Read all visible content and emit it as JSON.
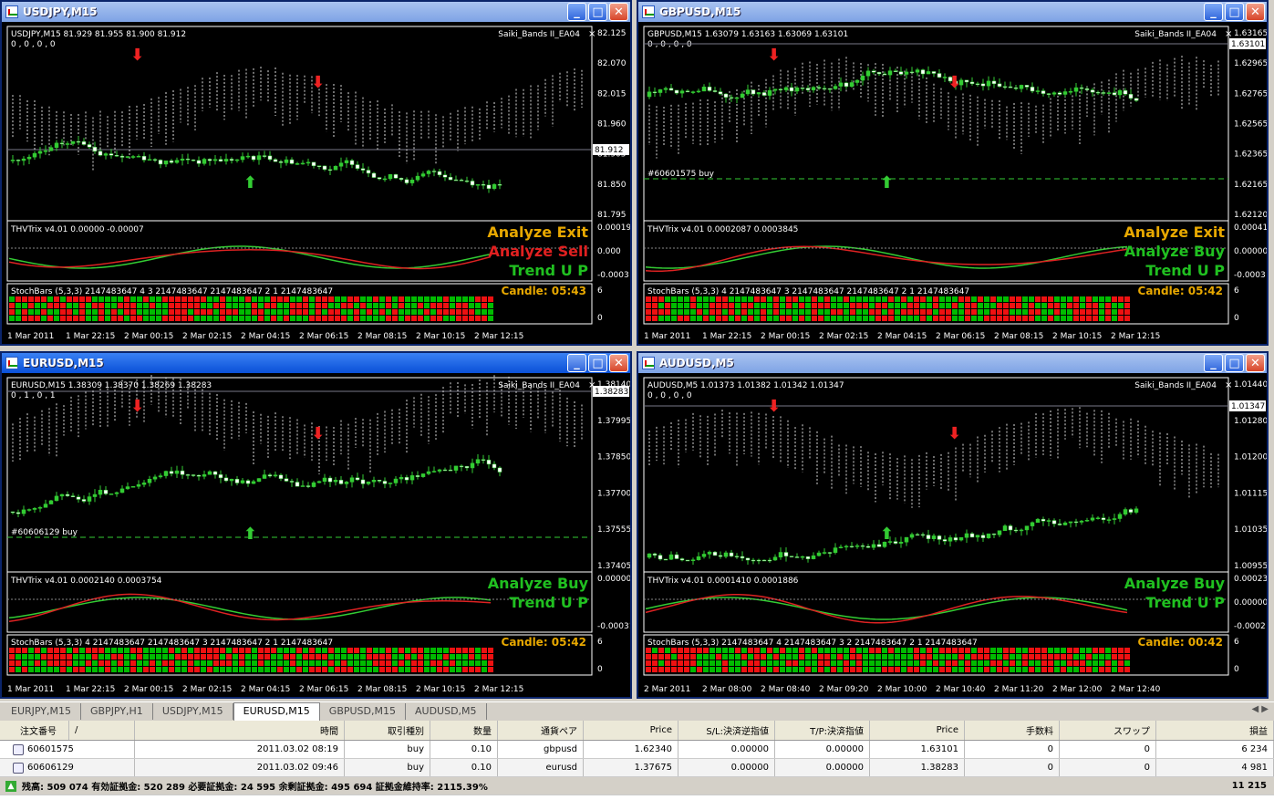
{
  "windows": [
    {
      "id": "usdjpy",
      "title": "USDJPY,M15",
      "info": "USDJPY,M15  81.929 81.955 81.900 81.912",
      "sub": "0 , 0 , 0 , 0",
      "ea": "Saiki_Bands II_EA04",
      "price": "81.912",
      "yticks": [
        "82.125",
        "82.070",
        "82.015",
        "81.960",
        "81.905",
        "81.850",
        "81.795"
      ],
      "labels": [
        {
          "text": "Analyze Exit",
          "color": "#e8a800"
        },
        {
          "text": "Analyze Sell",
          "color": "#e02020"
        },
        {
          "text": "Trend U P",
          "color": "#20c020"
        }
      ],
      "trix": "THVTrix v4.01 0.00000 -0.00007",
      "trixticks": [
        "0.00019",
        "0.000",
        "-0.0003"
      ],
      "stoch": "StochBars (5,3,3) 2147483647 4 3 2147483647 2147483647 2 1 2147483647",
      "candle": "Candle:  05:43",
      "stochticks": [
        "6",
        "0"
      ],
      "xticks": [
        "1 Mar 2011",
        "1 Mar 22:15",
        "2 Mar 00:15",
        "2 Mar 02:15",
        "2 Mar 04:15",
        "2 Mar 06:15",
        "2 Mar 08:15",
        "2 Mar 10:15",
        "2 Mar 12:15"
      ],
      "order": ""
    },
    {
      "id": "gbpusd",
      "title": "GBPUSD,M15",
      "info": "GBPUSD,M15  1.63079 1.63163 1.63069 1.63101",
      "sub": "0 , 0 , 0 , 0",
      "ea": "Saiki_Bands II_EA04",
      "price": "1.63101",
      "yticks": [
        "1.63165",
        "1.62965",
        "1.62765",
        "1.62565",
        "1.62365",
        "1.62165",
        "1.62120"
      ],
      "labels": [
        {
          "text": "Analyze Exit",
          "color": "#e8a800"
        },
        {
          "text": "Analyze Buy",
          "color": "#20c020"
        },
        {
          "text": "Trend U P",
          "color": "#20c020"
        }
      ],
      "trix": "THVTrix v4.01 0.0002087 0.0003845",
      "trixticks": [
        "0.000418",
        "0.00000",
        "-0.0003"
      ],
      "stoch": "StochBars (5,3,3) 4 2147483647 3 2147483647 2147483647 2 1 2147483647",
      "candle": "Candle:  05:42",
      "stochticks": [
        "6",
        "0"
      ],
      "xticks": [
        "1 Mar 2011",
        "1 Mar 22:15",
        "2 Mar 00:15",
        "2 Mar 02:15",
        "2 Mar 04:15",
        "2 Mar 06:15",
        "2 Mar 08:15",
        "2 Mar 10:15",
        "2 Mar 12:15"
      ],
      "order": "#60601575 buy"
    },
    {
      "id": "eurusd",
      "title": "EURUSD,M15",
      "info": "EURUSD,M15  1.38309 1.38370 1.38269 1.38283",
      "sub": "0 , 1 , 0 , 1",
      "ea": "Saiki_Bands II_EA04",
      "price": "1.38283",
      "yticks": [
        "1.38140",
        "1.37995",
        "1.37850",
        "1.37700",
        "1.37555",
        "1.37405"
      ],
      "labels": [
        {
          "text": "Analyze Buy",
          "color": "#20c020"
        },
        {
          "text": "Trend U P",
          "color": "#20c020"
        }
      ],
      "trix": "THVTrix v4.01 0.0002140 0.0003754",
      "trixticks": [
        "0.00000",
        "-0.00031"
      ],
      "stoch": "StochBars (5,3,3) 4 2147483647 2147483647 3 2147483647 2 1 2147483647",
      "candle": "Candle:  05:42",
      "stochticks": [
        "6",
        "0"
      ],
      "xticks": [
        "1 Mar 2011",
        "1 Mar 22:15",
        "2 Mar 00:15",
        "2 Mar 02:15",
        "2 Mar 04:15",
        "2 Mar 06:15",
        "2 Mar 08:15",
        "2 Mar 10:15",
        "2 Mar 12:15"
      ],
      "order": "#60606129 buy"
    },
    {
      "id": "audusd",
      "title": "AUDUSD,M5",
      "info": "AUDUSD,M5  1.01373 1.01382 1.01342 1.01347",
      "sub": "0 , 0 , 0 , 0",
      "ea": "Saiki_Bands II_EA04",
      "price": "1.01347",
      "yticks": [
        "1.01440",
        "1.01280",
        "1.01200",
        "1.01115",
        "1.01035",
        "1.00955"
      ],
      "labels": [
        {
          "text": "Analyze Buy",
          "color": "#20c020"
        },
        {
          "text": "Trend U P",
          "color": "#20c020"
        }
      ],
      "trix": "THVTrix v4.01 0.0001410 0.0001886",
      "trixticks": [
        "0.000234",
        "0.00000",
        "-0.0002"
      ],
      "stoch": "StochBars (5,3,3) 2147483647 4 2147483647 3 2 2147483647 2 1 2147483647",
      "candle": "Candle:  00:42",
      "stochticks": [
        "6",
        "0"
      ],
      "xticks": [
        "2 Mar 2011",
        "2 Mar 08:00",
        "2 Mar 08:40",
        "2 Mar 09:20",
        "2 Mar 10:00",
        "2 Mar 10:40",
        "2 Mar 11:20",
        "2 Mar 12:00",
        "2 Mar 12:40"
      ],
      "order": ""
    }
  ],
  "tabs": [
    "EURJPY,M15",
    "GBPJPY,H1",
    "USDJPY,M15",
    "EURUSD,M15",
    "GBPUSD,M15",
    "AUDUSD,M5"
  ],
  "active_tab": "EURUSD,M15",
  "terminal": {
    "headers": [
      "注文番号",
      "/",
      "時間",
      "取引種別",
      "数量",
      "通貨ペア",
      "Price",
      "S/L:決済逆指値",
      "T/P:決済指値",
      "Price",
      "手数料",
      "スワップ",
      "損益"
    ],
    "rows": [
      [
        "60601575",
        "2011.03.02 08:19",
        "buy",
        "0.10",
        "gbpusd",
        "1.62340",
        "0.00000",
        "0.00000",
        "1.63101",
        "0",
        "0",
        "6 234"
      ],
      [
        "60606129",
        "2011.03.02 09:46",
        "buy",
        "0.10",
        "eurusd",
        "1.37675",
        "0.00000",
        "0.00000",
        "1.38283",
        "0",
        "0",
        "4 981"
      ]
    ],
    "footer": "残高: 509 074  有効証拠金: 520 289  必要証拠金: 24 595  余剰証拠金: 495 694  証拠金維持率: 2115.39%",
    "footer_total": "11 215"
  }
}
